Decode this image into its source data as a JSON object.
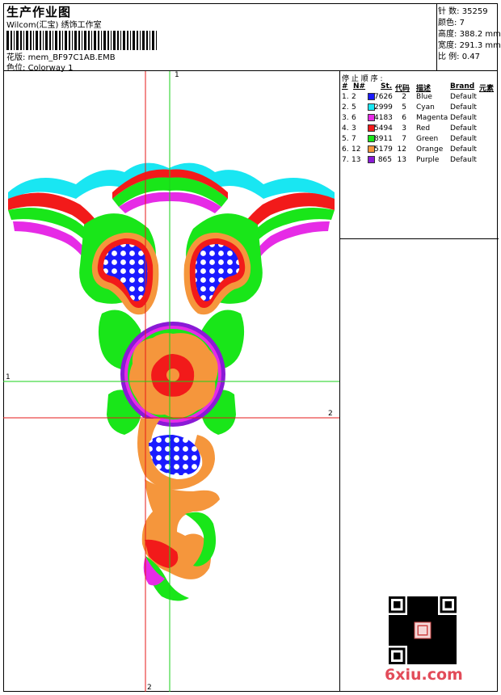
{
  "header": {
    "title": "生产作业图",
    "subtitle": "Wilcom(汇宝) 绣饰工作室",
    "design_label": "花版:",
    "design_value": "mem_BF97C1AB.EMB",
    "colorway_label": "色位:",
    "colorway_value": "Colorway 1"
  },
  "stats": {
    "stitches_label": "针 数:",
    "stitches": "35259",
    "colors_label": "颜色:",
    "colors": "7",
    "height_label": "高度:",
    "height": "388.2 mm",
    "width_label": "宽度:",
    "width": "291.3 mm",
    "scale_label": "比 例:",
    "scale": "0.47"
  },
  "sequence": {
    "title": "停 止 顺 序 :",
    "headers": [
      "#",
      "N#",
      "St.",
      "代码",
      "描述",
      "Brand",
      "元素"
    ],
    "rows": [
      {
        "idx": "1.",
        "n": "2",
        "st": "7626",
        "code": "2",
        "desc": "Blue",
        "brand": "Default",
        "color": "#1a1aff"
      },
      {
        "idx": "2.",
        "n": "5",
        "st": "2999",
        "code": "5",
        "desc": "Cyan",
        "brand": "Default",
        "color": "#19e6f2"
      },
      {
        "idx": "3.",
        "n": "6",
        "st": "4183",
        "code": "6",
        "desc": "Magenta",
        "brand": "Default",
        "color": "#e62be6"
      },
      {
        "idx": "4.",
        "n": "3",
        "st": "5494",
        "code": "3",
        "desc": "Red",
        "brand": "Default",
        "color": "#f21a1a"
      },
      {
        "idx": "5.",
        "n": "7",
        "st": "8911",
        "code": "7",
        "desc": "Green",
        "brand": "Default",
        "color": "#19e619"
      },
      {
        "idx": "6.",
        "n": "12",
        "st": "5179",
        "code": "12",
        "desc": "Orange",
        "brand": "Default",
        "color": "#f5963c"
      },
      {
        "idx": "7.",
        "n": "13",
        "st": "865",
        "code": "13",
        "desc": "Purple",
        "brand": "Default",
        "color": "#8a1ad6"
      }
    ]
  },
  "axes": {
    "v1": "1",
    "v2": "2",
    "h1": "1",
    "h2": "2",
    "green": "#1ad21a",
    "red": "#e61a1a"
  },
  "watermark": {
    "text": "6xiu.com",
    "color": "#e24b59"
  }
}
